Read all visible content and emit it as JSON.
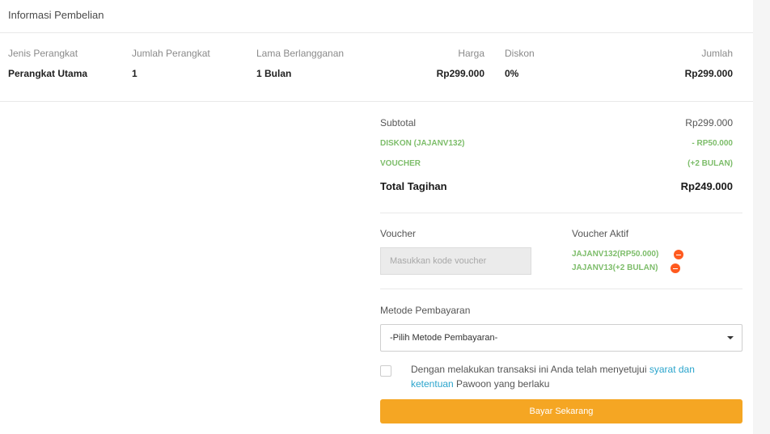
{
  "section_title": "Informasi Pembelian",
  "table": {
    "headers": {
      "device_type": "Jenis Perangkat",
      "device_count": "Jumlah Perangkat",
      "duration": "Lama Berlangganan",
      "price": "Harga",
      "discount": "Diskon",
      "amount": "Jumlah"
    },
    "row": {
      "device_type": "Perangkat Utama",
      "device_count": "1",
      "duration": "1 Bulan",
      "price": "Rp299.000",
      "discount": "0%",
      "amount": "Rp299.000"
    }
  },
  "summary": {
    "subtotal_label": "Subtotal",
    "subtotal_value": "Rp299.000",
    "discount_label": "DISKON (JAJANV132)",
    "discount_value": "- RP50.000",
    "voucher_label": "VOUCHER",
    "voucher_value": "(+2 BULAN)",
    "total_label": "Total Tagihan",
    "total_value": "Rp249.000"
  },
  "voucher": {
    "label": "Voucher",
    "placeholder": "Masukkan kode voucher",
    "active_label": "Voucher Aktif",
    "active_items": [
      "JAJANV132(RP50.000)",
      "JAJANV13(+2 BULAN)"
    ]
  },
  "payment": {
    "label": "Metode Pembayaran",
    "selected": "-Pilih Metode Pembayaran-"
  },
  "terms": {
    "text_before": "Dengan melakukan transaksi ini Anda telah menyetujui ",
    "link": "syarat dan ketentuan",
    "text_after": " Pawoon yang berlaku"
  },
  "pay_button_label": "Bayar Sekarang",
  "colors": {
    "accent_orange": "#f5a623",
    "voucher_green": "#7dbd6a",
    "link_blue": "#2aa4cc",
    "remove_red": "#ff5a1f"
  }
}
